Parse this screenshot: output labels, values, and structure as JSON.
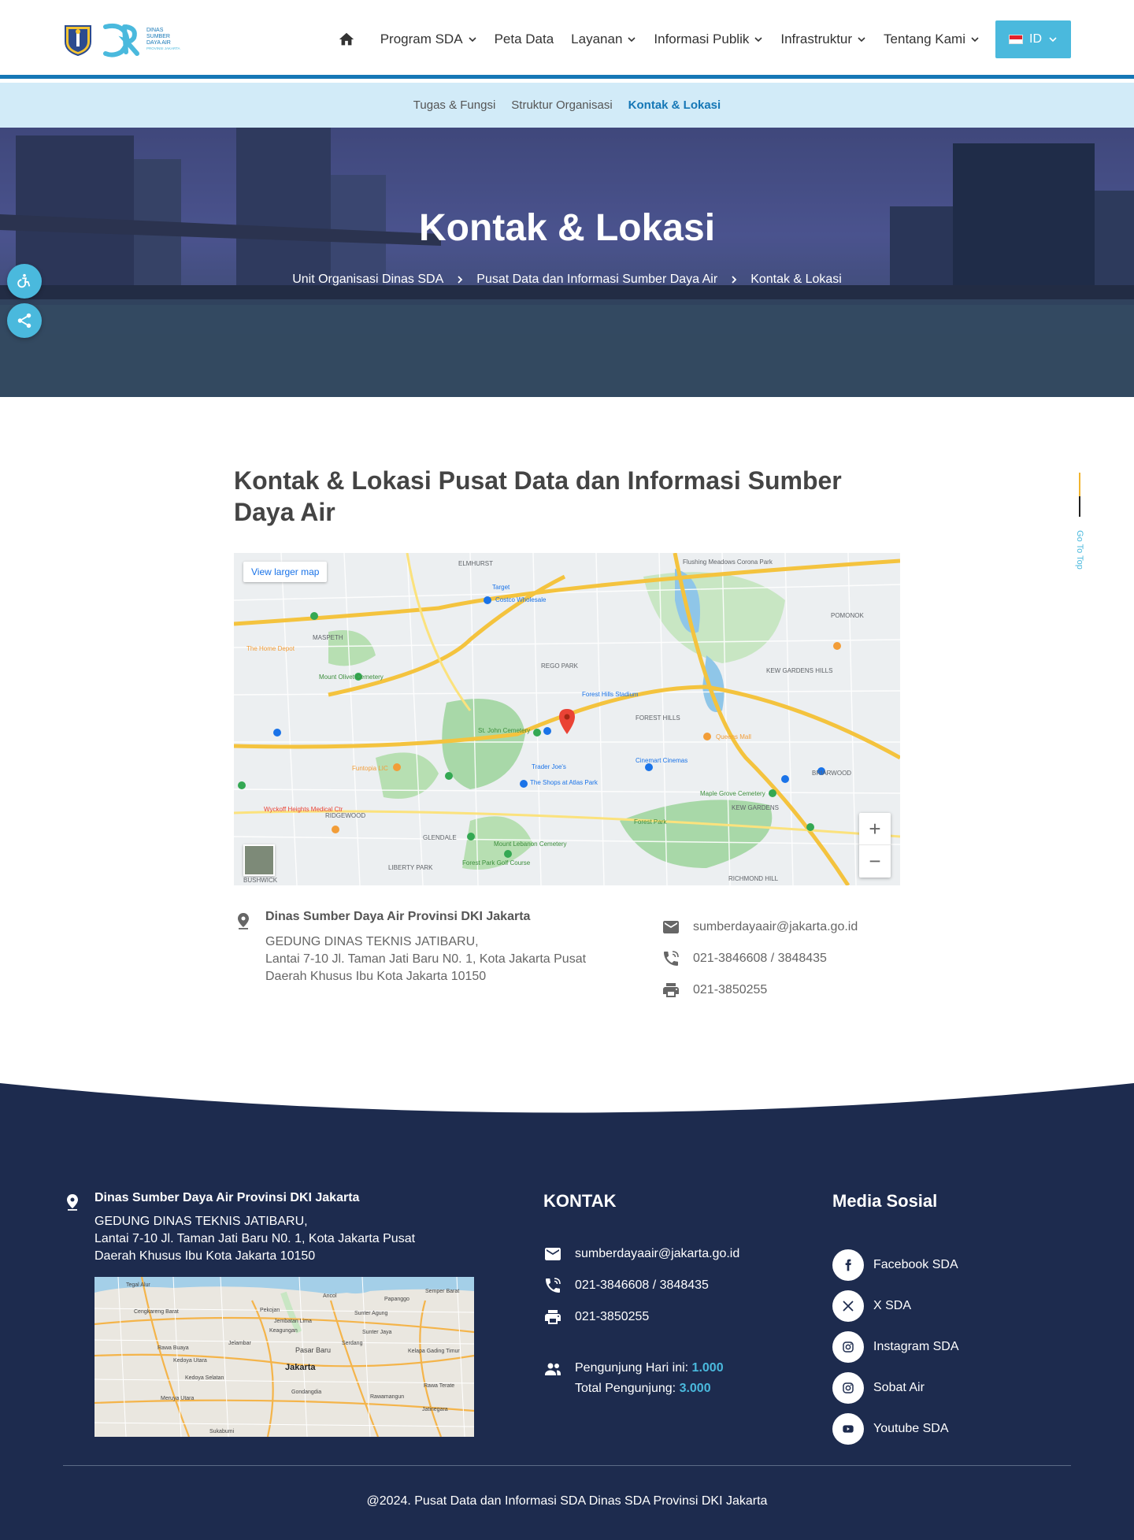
{
  "header": {
    "nav": [
      {
        "label": "Program SDA",
        "dropdown": true
      },
      {
        "label": "Peta Data",
        "dropdown": false
      },
      {
        "label": "Layanan",
        "dropdown": true
      },
      {
        "label": "Informasi Publik",
        "dropdown": true
      },
      {
        "label": "Infrastruktur",
        "dropdown": true
      },
      {
        "label": "Tentang Kami",
        "dropdown": true
      }
    ],
    "lang": "ID"
  },
  "logo": {
    "lines": [
      "DINAS",
      "SUMBER",
      "DAYA AIR",
      "PROVINSI JAKARTA"
    ]
  },
  "subnav": [
    {
      "label": "Tugas & Fungsi",
      "active": false
    },
    {
      "label": "Struktur Organisasi",
      "active": false
    },
    {
      "label": "Kontak & Lokasi",
      "active": true
    }
  ],
  "hero": {
    "title": "Kontak & Lokasi",
    "breadcrumb": [
      "Unit Organisasi Dinas SDA",
      "Pusat Data dan Informasi Sumber Daya Air",
      "Kontak & Lokasi"
    ]
  },
  "main": {
    "heading": "Kontak & Lokasi Pusat Data dan Informasi Sumber Daya Air",
    "map": {
      "view_larger": "View larger map",
      "labels": [
        "ELMHURST",
        "Flushing Meadows Corona Park",
        "MASPETH",
        "REGO PARK",
        "FOREST HILLS",
        "KEW GARDENS HILLS",
        "POMONOK",
        "RIDGEWOOD",
        "GLENDALE",
        "LIBERTY PARK",
        "KEW GARDENS",
        "BRIARWOOD",
        "RICHMOND HILL",
        "BUSHWICK",
        "Forest Park",
        "Forest Hills Stadium",
        "St. John Cemetery",
        "Mount Olivet Cemetery",
        "Costco Wholesale",
        "Target",
        "The Home Depot",
        "Trader Joe's",
        "The Shops at Atlas Park",
        "Queens Mall",
        "Cinemart Cinemas",
        "Maple Grove Cemetery",
        "Forest Park Golf Course",
        "Mount Lebanon Cemetery",
        "Funtopia LIC",
        "Wyckoff Heights Medical Ctr"
      ]
    },
    "address": {
      "name": "Dinas Sumber Daya Air Provinsi DKI Jakarta",
      "lines": [
        "GEDUNG DINAS TEKNIS JATIBARU,",
        "Lantai 7-10 Jl. Taman Jati Baru N0. 1, Kota Jakarta Pusat",
        "Daerah Khusus Ibu Kota Jakarta 10150"
      ]
    },
    "contacts": [
      {
        "icon": "mail-icon",
        "text": "sumberdayaair@jakarta.go.id"
      },
      {
        "icon": "phone-icon",
        "text": "021-3846608 / 3848435"
      },
      {
        "icon": "printer-icon",
        "text": "021-3850255"
      }
    ]
  },
  "go_to_top": "Go To Top",
  "footer": {
    "address": {
      "name": "Dinas Sumber Daya Air Provinsi DKI Jakarta",
      "lines": [
        "GEDUNG DINAS TEKNIS JATIBARU,",
        "Lantai 7-10 Jl. Taman Jati Baru N0. 1, Kota Jakarta Pusat",
        "Daerah Khusus Ibu Kota Jakarta 10150"
      ]
    },
    "map_labels": [
      "Tegal Alur",
      "Cengkareng Barat",
      "Pekojan",
      "Jembatan Lima",
      "Keagungan",
      "Ancol",
      "Papanggo",
      "Sunter Agung",
      "Sunter Jaya",
      "Semper Barat",
      "Rawa Buaya",
      "Jelambar",
      "Pasar Baru",
      "Serdang",
      "Kelapa Gading Timur",
      "Kedoya Utara",
      "Kedoya Selatan",
      "Jakarta",
      "Rawa Terate",
      "Meruya Utara",
      "Gondangdia",
      "Rawamangun",
      "Jatinegara",
      "Sukabumi"
    ],
    "kontak_title": "KONTAK",
    "contacts": [
      {
        "icon": "mail-icon",
        "text": "sumberdayaair@jakarta.go.id"
      },
      {
        "icon": "phone-icon",
        "text": "021-3846608 / 3848435"
      },
      {
        "icon": "printer-icon",
        "text": "021-3850255"
      }
    ],
    "visitors": {
      "today_label": "Pengunjung Hari ini:",
      "today_value": "1.000",
      "total_label": "Total Pengunjung:",
      "total_value": "3.000"
    },
    "social_title": "Media Sosial",
    "social": [
      {
        "icon": "facebook-icon",
        "label": "Facebook SDA"
      },
      {
        "icon": "x-icon",
        "label": "X SDA"
      },
      {
        "icon": "instagram-icon",
        "label": "Instagram SDA"
      },
      {
        "icon": "instagram-icon",
        "label": "Sobat Air"
      },
      {
        "icon": "youtube-icon",
        "label": "Youtube SDA"
      }
    ],
    "copyright": "@2024. Pusat Data dan Informasi SDA Dinas SDA Provinsi DKI Jakarta"
  },
  "colors": {
    "primary": "#1577b6",
    "accent": "#4ab9dd",
    "footer_bg": "#1d2b4e",
    "subnav_bg": "#d2ebf8"
  }
}
